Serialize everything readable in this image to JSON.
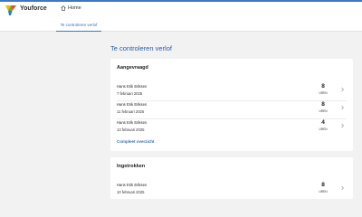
{
  "app": {
    "brand": "Youforce"
  },
  "nav": {
    "home_label": "Home"
  },
  "subnav": {
    "tab_label": "Te controleren verlof"
  },
  "page": {
    "title": "Te controleren verlof"
  },
  "requested": {
    "title": "Aangevraagd",
    "items": [
      {
        "name": "Hans Erik Eriksen",
        "date": "7 februari 2025",
        "hours": "8",
        "unit": "UREN"
      },
      {
        "name": "Hans Erik Eriksen",
        "date": "11 februari 2025",
        "hours": "8",
        "unit": "UREN"
      },
      {
        "name": "Hans Erik Eriksen",
        "date": "13 februari 2025",
        "hours": "4",
        "unit": "UREN"
      }
    ],
    "full_overview_label": "Compleet overzicht"
  },
  "withdrawn": {
    "title": "Ingetrokken",
    "items": [
      {
        "name": "Hans Erik Eriksen",
        "date": "10 februari 2025",
        "hours": "8",
        "unit": "UREN"
      }
    ]
  },
  "colors": {
    "accent": "#3a78c9",
    "title": "#2c5fa3",
    "background": "#f2f2f2"
  },
  "icons": {
    "home": "home-icon",
    "chevron": "chevron-right-icon",
    "logo": "youforce-logo"
  }
}
